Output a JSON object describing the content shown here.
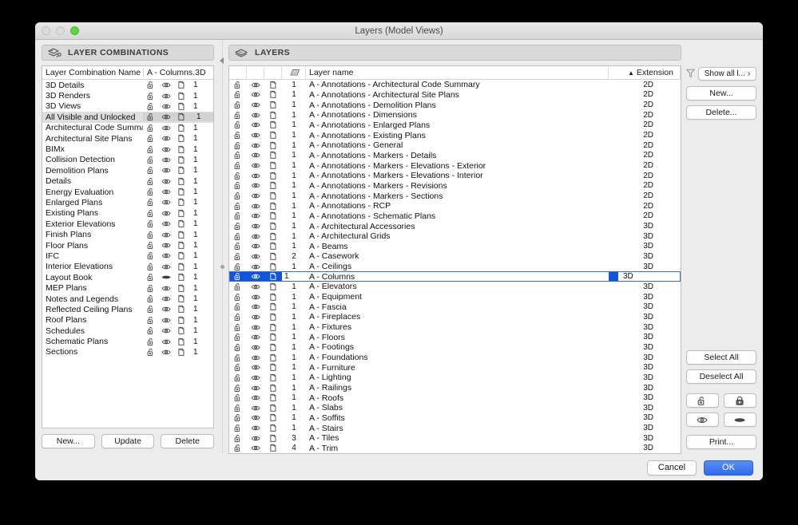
{
  "window": {
    "title": "Layers (Model Views)",
    "traffic_lights": [
      "close",
      "minimize",
      "zoom"
    ]
  },
  "left_panel": {
    "header_label": "LAYER COMBINATIONS",
    "header_icon": "layer-combinations-icon",
    "columns": [
      "Layer Combination Name",
      "A - Columns.3D"
    ],
    "selected": "All Visible and Unlocked",
    "rows": [
      {
        "name": "3D Details",
        "lock": "unlocked",
        "eye": "visible",
        "wireframe": "wireframe",
        "count": "1"
      },
      {
        "name": "3D Renders",
        "lock": "unlocked",
        "eye": "visible",
        "wireframe": "wireframe",
        "count": "1"
      },
      {
        "name": "3D Views",
        "lock": "unlocked",
        "eye": "visible",
        "wireframe": "wireframe",
        "count": "1"
      },
      {
        "name": "All Visible and Unlocked",
        "lock": "unlocked",
        "eye": "visible",
        "wireframe": "wireframe",
        "count": "1"
      },
      {
        "name": "Architectural Code Summary",
        "lock": "unlocked",
        "eye": "visible",
        "wireframe": "wireframe",
        "count": "1"
      },
      {
        "name": "Architectural Site Plans",
        "lock": "unlocked",
        "eye": "visible",
        "wireframe": "wireframe",
        "count": "1"
      },
      {
        "name": "BIMx",
        "lock": "unlocked",
        "eye": "visible",
        "wireframe": "wireframe",
        "count": "1"
      },
      {
        "name": "Collision Detection",
        "lock": "unlocked",
        "eye": "visible",
        "wireframe": "wireframe",
        "count": "1"
      },
      {
        "name": "Demolition Plans",
        "lock": "unlocked",
        "eye": "visible",
        "wireframe": "wireframe",
        "count": "1"
      },
      {
        "name": "Details",
        "lock": "unlocked",
        "eye": "visible",
        "wireframe": "wireframe",
        "count": "1"
      },
      {
        "name": "Energy Evaluation",
        "lock": "unlocked",
        "eye": "visible",
        "wireframe": "wireframe",
        "count": "1"
      },
      {
        "name": "Enlarged Plans",
        "lock": "unlocked",
        "eye": "visible",
        "wireframe": "wireframe",
        "count": "1"
      },
      {
        "name": "Existing Plans",
        "lock": "unlocked",
        "eye": "visible",
        "wireframe": "wireframe",
        "count": "1"
      },
      {
        "name": "Exterior Elevations",
        "lock": "unlocked",
        "eye": "visible",
        "wireframe": "wireframe",
        "count": "1"
      },
      {
        "name": "Finish Plans",
        "lock": "unlocked",
        "eye": "visible",
        "wireframe": "wireframe",
        "count": "1"
      },
      {
        "name": "Floor Plans",
        "lock": "unlocked",
        "eye": "visible",
        "wireframe": "wireframe",
        "count": "1"
      },
      {
        "name": "IFC",
        "lock": "unlocked",
        "eye": "visible",
        "wireframe": "wireframe",
        "count": "1"
      },
      {
        "name": "Interior Elevations",
        "lock": "unlocked",
        "eye": "visible",
        "wireframe": "wireframe",
        "count": "1"
      },
      {
        "name": "Layout Book",
        "lock": "unlocked",
        "eye": "hidden",
        "wireframe": "wireframe",
        "count": "1"
      },
      {
        "name": "MEP Plans",
        "lock": "unlocked",
        "eye": "visible",
        "wireframe": "wireframe",
        "count": "1"
      },
      {
        "name": "Notes and Legends",
        "lock": "unlocked",
        "eye": "visible",
        "wireframe": "wireframe",
        "count": "1"
      },
      {
        "name": "Reflected Ceiling Plans",
        "lock": "unlocked",
        "eye": "visible",
        "wireframe": "wireframe",
        "count": "1"
      },
      {
        "name": "Roof Plans",
        "lock": "unlocked",
        "eye": "visible",
        "wireframe": "wireframe",
        "count": "1"
      },
      {
        "name": "Schedules",
        "lock": "unlocked",
        "eye": "visible",
        "wireframe": "wireframe",
        "count": "1"
      },
      {
        "name": "Schematic Plans",
        "lock": "unlocked",
        "eye": "visible",
        "wireframe": "wireframe",
        "count": "1"
      },
      {
        "name": "Sections",
        "lock": "unlocked",
        "eye": "visible",
        "wireframe": "wireframe",
        "count": "1"
      }
    ],
    "buttons": [
      "New...",
      "Update",
      "Delete"
    ]
  },
  "right_panel": {
    "header_label": "LAYERS",
    "header_icon": "layers-stack-icon",
    "columns": {
      "lock": "",
      "eye": "",
      "wireframe": "",
      "intersection_icon": "intersection-group-icon",
      "name": "Layer name",
      "extension": "Extension",
      "sort_indicator": "▲"
    },
    "selected_layer": "A - Columns",
    "rows": [
      {
        "name": "A - Annotations - Architectural Code Summary",
        "num": "1",
        "ext": "2D"
      },
      {
        "name": "A - Annotations - Architectural Site Plans",
        "num": "1",
        "ext": "2D"
      },
      {
        "name": "A - Annotations - Demolition Plans",
        "num": "1",
        "ext": "2D"
      },
      {
        "name": "A - Annotations - Dimensions",
        "num": "1",
        "ext": "2D"
      },
      {
        "name": "A - Annotations - Enlarged Plans",
        "num": "1",
        "ext": "2D"
      },
      {
        "name": "A - Annotations - Existing Plans",
        "num": "1",
        "ext": "2D"
      },
      {
        "name": "A - Annotations - General",
        "num": "1",
        "ext": "2D"
      },
      {
        "name": "A - Annotations - Markers - Details",
        "num": "1",
        "ext": "2D"
      },
      {
        "name": "A - Annotations - Markers - Elevations - Exterior",
        "num": "1",
        "ext": "2D"
      },
      {
        "name": "A - Annotations - Markers - Elevations - Interior",
        "num": "1",
        "ext": "2D"
      },
      {
        "name": "A - Annotations - Markers - Revisions",
        "num": "1",
        "ext": "2D"
      },
      {
        "name": "A - Annotations - Markers - Sections",
        "num": "1",
        "ext": "2D"
      },
      {
        "name": "A - Annotations - RCP",
        "num": "1",
        "ext": "2D"
      },
      {
        "name": "A - Annotations - Schematic Plans",
        "num": "1",
        "ext": "2D"
      },
      {
        "name": "A - Architectural Accessories",
        "num": "1",
        "ext": "3D"
      },
      {
        "name": "A - Architectural Grids",
        "num": "1",
        "ext": "3D"
      },
      {
        "name": "A - Beams",
        "num": "1",
        "ext": "3D"
      },
      {
        "name": "A - Casework",
        "num": "2",
        "ext": "3D"
      },
      {
        "name": "A - Ceilings",
        "num": "1",
        "ext": "3D"
      },
      {
        "name": "A - Columns",
        "num": "1",
        "ext": "3D"
      },
      {
        "name": "A - Elevators",
        "num": "1",
        "ext": "3D"
      },
      {
        "name": "A - Equipment",
        "num": "1",
        "ext": "3D"
      },
      {
        "name": "A - Fascia",
        "num": "1",
        "ext": "3D"
      },
      {
        "name": "A - Fireplaces",
        "num": "1",
        "ext": "3D"
      },
      {
        "name": "A - Fixtures",
        "num": "1",
        "ext": "3D"
      },
      {
        "name": "A - Floors",
        "num": "1",
        "ext": "3D"
      },
      {
        "name": "A - Footings",
        "num": "1",
        "ext": "3D"
      },
      {
        "name": "A - Foundations",
        "num": "1",
        "ext": "3D"
      },
      {
        "name": "A - Furniture",
        "num": "1",
        "ext": "3D"
      },
      {
        "name": "A - Lighting",
        "num": "1",
        "ext": "3D"
      },
      {
        "name": "A - Railings",
        "num": "1",
        "ext": "3D"
      },
      {
        "name": "A - Roofs",
        "num": "1",
        "ext": "3D"
      },
      {
        "name": "A - Slabs",
        "num": "1",
        "ext": "3D"
      },
      {
        "name": "A - Soffits",
        "num": "1",
        "ext": "3D"
      },
      {
        "name": "A - Stairs",
        "num": "1",
        "ext": "3D"
      },
      {
        "name": "A - Tiles",
        "num": "3",
        "ext": "3D"
      },
      {
        "name": "A - Trim",
        "num": "4",
        "ext": "3D"
      }
    ],
    "side": {
      "filter_icon": "filter-funnel-icon",
      "show_all": "Show all l...",
      "show_all_chevron": "›",
      "new": "New...",
      "delete": "Delete...",
      "select_all": "Select All",
      "deselect_all": "Deselect All",
      "icon_buttons": [
        "unlock-icon",
        "lock-icon",
        "eye-open-icon",
        "eye-closed-icon"
      ],
      "print": "Print..."
    }
  },
  "footer": {
    "cancel": "Cancel",
    "ok": "OK"
  },
  "colors": {
    "selection_blue": "#1455d6",
    "primary_button": "#2f6ae8",
    "window_chrome": "#ececec",
    "row_highlight": "#dedede"
  }
}
